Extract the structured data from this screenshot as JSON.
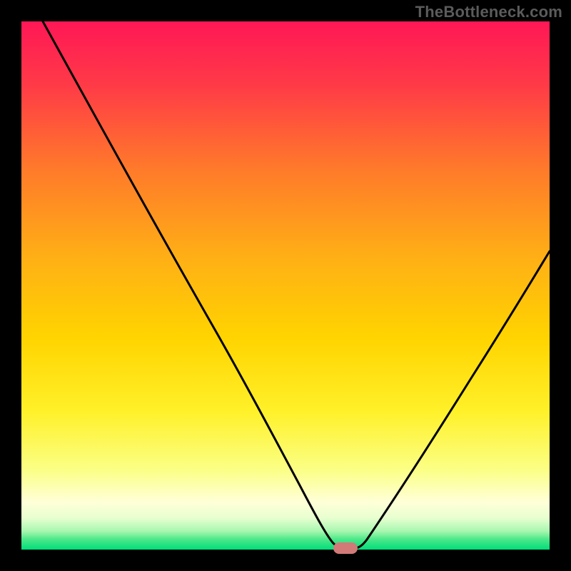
{
  "watermark": "TheBottleneck.com",
  "chart_data": {
    "type": "line",
    "title": "",
    "xlabel": "",
    "ylabel": "",
    "xlim": [
      0,
      100
    ],
    "ylim": [
      0,
      100
    ],
    "x": [
      0,
      5,
      10,
      15,
      20,
      25,
      30,
      35,
      40,
      45,
      50,
      55,
      57,
      60,
      61,
      65,
      70,
      75,
      80,
      85,
      90,
      95,
      100
    ],
    "values": [
      100,
      92,
      84,
      76,
      68,
      60,
      50,
      41,
      32,
      23,
      14,
      5,
      1,
      0,
      0,
      6,
      14,
      22,
      30,
      38,
      46,
      53,
      60
    ],
    "marker": {
      "x": 60.5,
      "y": 0
    },
    "background_gradient": {
      "top": "#ff1a55",
      "upper_mid": "#ff7a2a",
      "mid": "#ffd400",
      "lower_mid": "#f7ff3d",
      "pale": "#ffffd0",
      "bottom": "#00e46a"
    },
    "borders": {
      "left": true,
      "right": true,
      "top": true,
      "bottom": true,
      "color": "#000000",
      "thickness_px": 30
    }
  }
}
